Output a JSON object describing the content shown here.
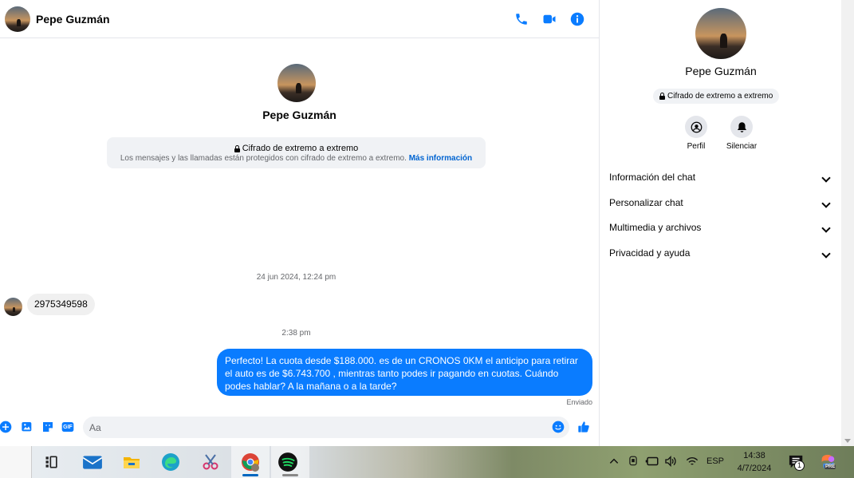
{
  "header": {
    "contact_name": "Pepe Guzmán",
    "icons": [
      "phone-icon",
      "video-camera-icon",
      "info-icon"
    ]
  },
  "conversation_intro": {
    "contact_name": "Pepe Guzmán",
    "encryption_title": "Cifrado de extremo a extremo",
    "encryption_desc": "Los mensajes y las llamadas están protegidos con cifrado de extremo a extremo.",
    "encryption_link": "Más información"
  },
  "messages": [
    {
      "timestamp": "24 jun 2024, 12:24 pm",
      "direction": "received",
      "text": "2975349598"
    },
    {
      "timestamp": "2:38 pm",
      "direction": "sent",
      "text": "Perfecto! La cuota desde $188.000. es de un CRONOS 0KM el anticipo para retirar el auto es de $6.743.700 , mientras tanto podes ir pagando en cuotas. Cuándo podes hablar? A la mañana o a la tarde?",
      "status": "Enviado"
    }
  ],
  "composer": {
    "placeholder": "Aa",
    "icons": [
      "plus-icon",
      "image-icon",
      "sticker-icon",
      "gif-icon",
      "emoji-icon",
      "thumbs-up-icon"
    ],
    "gif_label": "GIF"
  },
  "panel": {
    "contact_name": "Pepe Guzmán",
    "encryption_badge": "Cifrado de extremo a extremo",
    "actions": [
      {
        "label": "Perfil",
        "icon": "profile-icon"
      },
      {
        "label": "Silenciar",
        "icon": "bell-icon"
      }
    ],
    "sections": [
      {
        "label": "Información del chat"
      },
      {
        "label": "Personalizar chat"
      },
      {
        "label": "Multimedia y archivos"
      },
      {
        "label": "Privacidad y ayuda"
      }
    ]
  },
  "taskbar": {
    "apps": [
      "task-view-icon",
      "mail-icon",
      "file-explorer-icon",
      "edge-icon",
      "snipping-tool-icon",
      "chrome-icon",
      "spotify-icon"
    ],
    "language": "ESP",
    "time": "14:38",
    "date": "4/7/2024",
    "notification_count": "1",
    "copilot_badge": "PRE"
  },
  "colors": {
    "accent": "#0a7cff",
    "sent_bubble": "#0a7cff",
    "received_bubble": "#f0f0f0",
    "link": "#0064d1"
  }
}
